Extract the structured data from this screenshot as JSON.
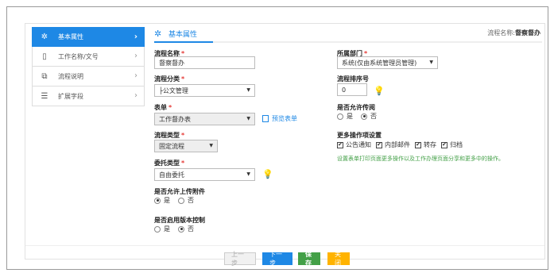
{
  "sidebar": {
    "items": [
      {
        "label": "基本属性",
        "icon": "gear-icon"
      },
      {
        "label": "工作名称/文号",
        "icon": "document-icon"
      },
      {
        "label": "流程说明",
        "icon": "flow-icon"
      },
      {
        "label": "扩展字段",
        "icon": "list-icon"
      }
    ]
  },
  "header": {
    "title": "基本属性",
    "flow_name_label": "流程名称:",
    "flow_name_value": "督察督办"
  },
  "form": {
    "flow_name": {
      "label": "流程名称",
      "value": "督察督办"
    },
    "department": {
      "label": "所属部门",
      "value": "系统(仅由系统管理员管理)"
    },
    "flow_category": {
      "label": "流程分类",
      "value": "├公文管理"
    },
    "flow_order": {
      "label": "流程排序号",
      "value": "0"
    },
    "form": {
      "label": "表单",
      "value": "工作督办表",
      "preview": "预览表单"
    },
    "allow_return": {
      "label": "是否允许传阅",
      "yes": "是",
      "no": "否",
      "selected": "no"
    },
    "flow_type": {
      "label": "流程类型",
      "value": "固定流程"
    },
    "more_ops": {
      "label": "更多操作项设置",
      "options": [
        {
          "label": "公告通知",
          "checked": true
        },
        {
          "label": "内部邮件",
          "checked": true
        },
        {
          "label": "转存",
          "checked": true
        },
        {
          "label": "归档",
          "checked": true
        }
      ]
    },
    "ops_note": "设置表单打印页面更多操作以及工作办理页面分享和更多中的操作。",
    "delegate_type": {
      "label": "委托类型",
      "value": "自由委托"
    },
    "allow_upload": {
      "label": "是否允许上传附件",
      "yes": "是",
      "no": "否",
      "selected": "yes"
    },
    "version_control": {
      "label": "是否启用版本控制",
      "yes": "是",
      "no": "否",
      "selected": "no"
    }
  },
  "buttons": {
    "prev": "上一步",
    "next": "下一步",
    "save": "保存",
    "close": "关闭"
  },
  "colors": {
    "accent": "#1e88e5",
    "save": "#43a047",
    "close": "#ffb300",
    "required": "#e53935"
  }
}
